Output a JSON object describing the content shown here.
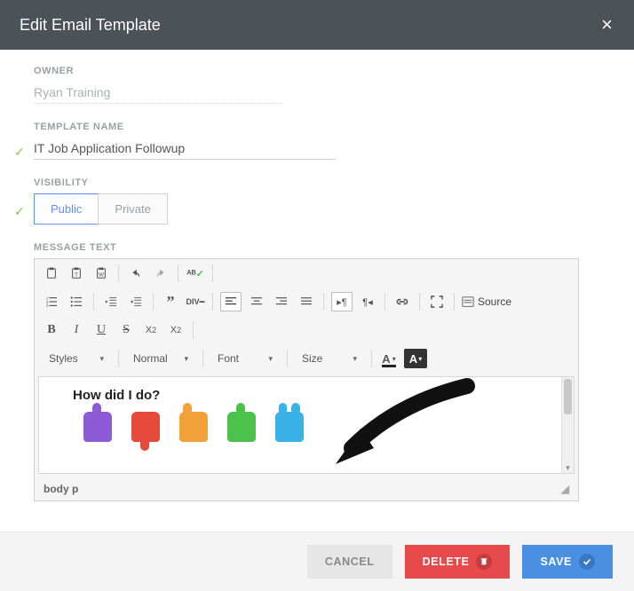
{
  "header": {
    "title": "Edit Email Template",
    "close_label": "×"
  },
  "owner": {
    "label": "OWNER",
    "value": "Ryan Training"
  },
  "templateName": {
    "label": "TEMPLATE NAME",
    "value": "IT Job Application Followup"
  },
  "visibility": {
    "label": "VISIBILITY",
    "options": [
      "Public",
      "Private"
    ],
    "selected": "Public"
  },
  "message": {
    "label": "MESSAGE TEXT",
    "toolbar": {
      "styles_label": "Styles",
      "format_label": "Normal",
      "font_label": "Font",
      "size_label": "Size",
      "source_label": "Source"
    },
    "content_heading": "How did I do?",
    "rating_icons": [
      "angry-hand",
      "thumbs-down-hand",
      "point-hand",
      "thumbs-up-hand",
      "rock-on-hand"
    ],
    "element_path": "body   p"
  },
  "footer": {
    "cancel": "CANCEL",
    "delete": "DELETE",
    "save": "SAVE"
  }
}
